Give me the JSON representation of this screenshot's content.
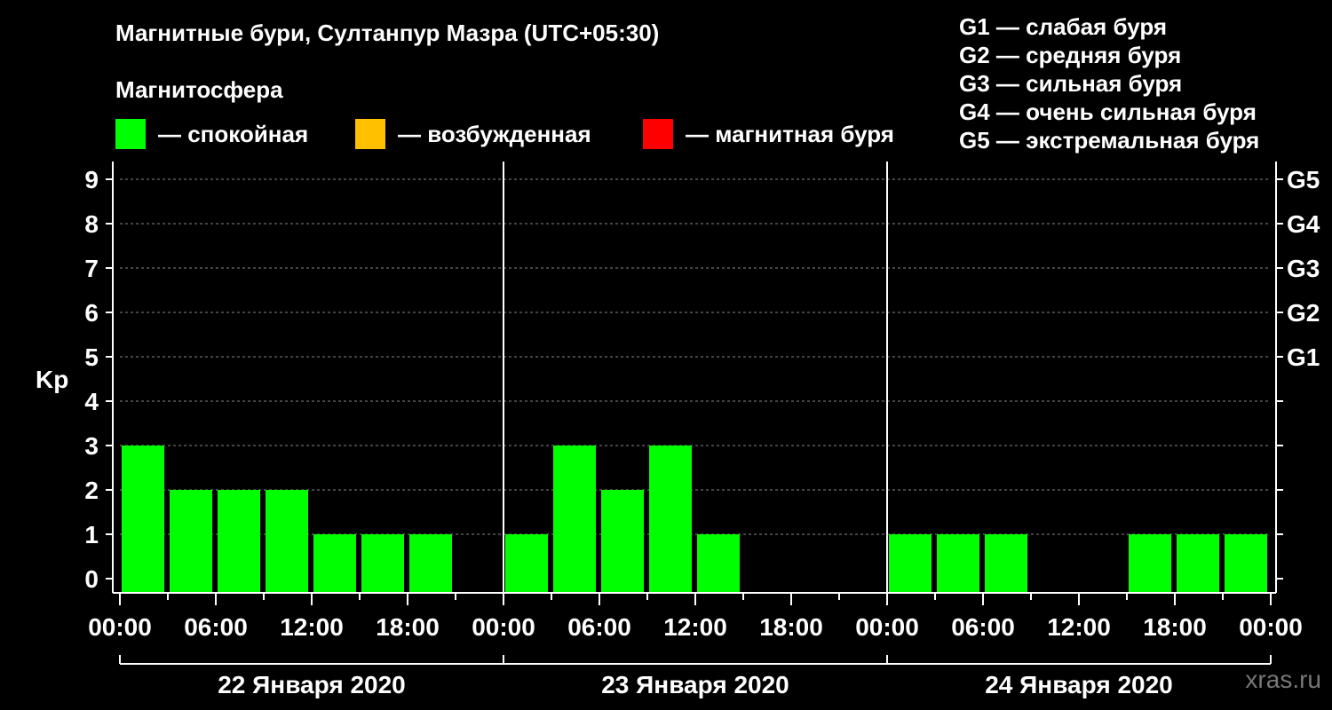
{
  "header": {
    "title": "Магнитные бури, Султанпур Мазра (UTC+05:30)",
    "subtitle": "Магнитосфера"
  },
  "legend": [
    {
      "color": "#00ff00",
      "label": "— спокойная"
    },
    {
      "color": "#ffc000",
      "label": "— возбужденная"
    },
    {
      "color": "#ff0000",
      "label": "— магнитная буря"
    }
  ],
  "gscale": [
    "G1 — слабая буря",
    "G2 — средняя буря",
    "G3 — сильная буря",
    "G4 — очень сильная буря",
    "G5 — экстремальная буря"
  ],
  "watermark": "xras.ru",
  "chart_data": {
    "type": "bar",
    "ylabel": "Kp",
    "ylim": [
      0,
      9
    ],
    "yticks": [
      "0",
      "1",
      "2",
      "3",
      "4",
      "5",
      "6",
      "7",
      "8",
      "9"
    ],
    "right_axis_labels": [
      {
        "kp": 5,
        "label": "G1"
      },
      {
        "kp": 6,
        "label": "G2"
      },
      {
        "kp": 7,
        "label": "G3"
      },
      {
        "kp": 8,
        "label": "G4"
      },
      {
        "kp": 9,
        "label": "G5"
      }
    ],
    "xtick_labels": [
      "00:00",
      "06:00",
      "12:00",
      "18:00",
      "00:00",
      "06:00",
      "12:00",
      "18:00",
      "00:00",
      "06:00",
      "12:00",
      "18:00",
      "00:00"
    ],
    "days": [
      "22 Января 2020",
      "23 Января 2020",
      "24 Января 2020"
    ],
    "grid": true,
    "bar_color": "#00ff00",
    "values": [
      [
        3,
        2,
        2,
        2,
        1,
        1,
        1,
        0
      ],
      [
        1,
        3,
        2,
        3,
        1,
        0,
        0,
        0
      ],
      [
        1,
        1,
        1,
        0,
        0,
        1,
        1,
        1
      ]
    ]
  }
}
